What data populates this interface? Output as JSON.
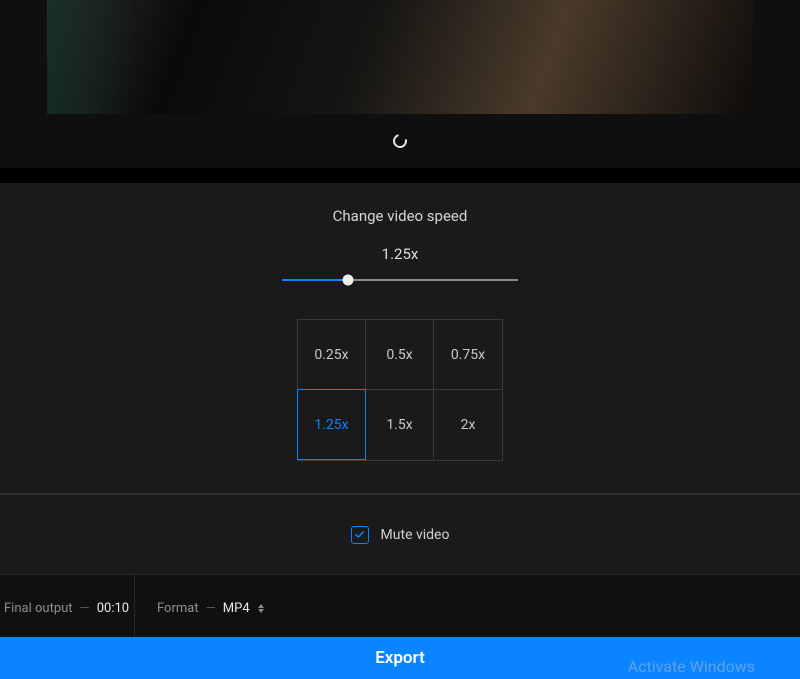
{
  "speed": {
    "title": "Change video speed",
    "current": "1.25x",
    "slider_percent": 28,
    "presets": [
      "0.25x",
      "0.5x",
      "0.75x",
      "1.25x",
      "1.5x",
      "2x"
    ],
    "selected_preset": "1.25x"
  },
  "mute": {
    "label": "Mute video",
    "checked": true
  },
  "output": {
    "label": "Final output",
    "duration": "00:10"
  },
  "format": {
    "label": "Format",
    "value": "MP4"
  },
  "export_label": "Export",
  "watermark": "Activate Windows",
  "colors": {
    "accent": "#0a84ff"
  }
}
